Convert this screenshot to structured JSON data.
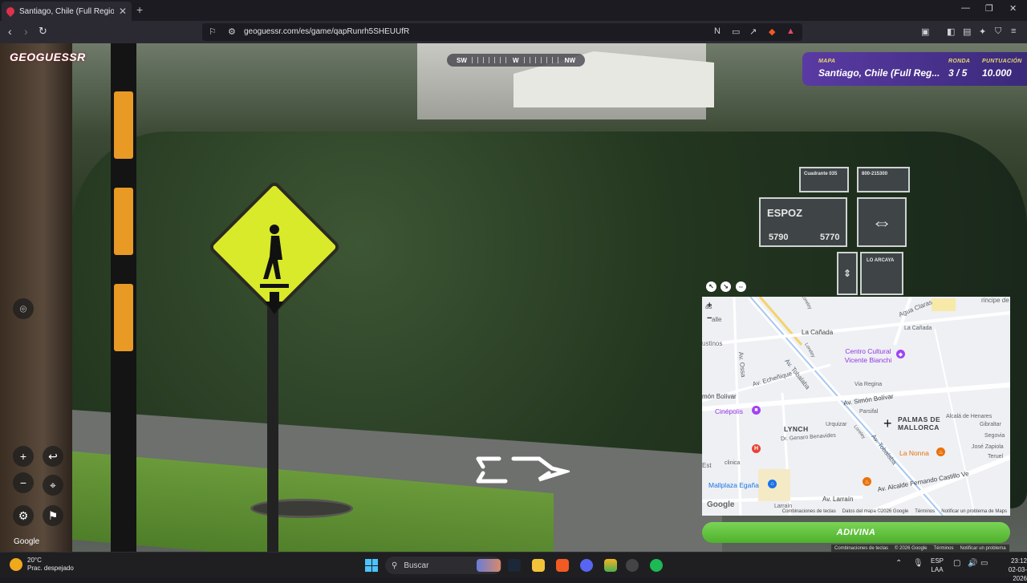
{
  "browser": {
    "tab_title": "Santiago, Chile (Full Region Met…",
    "tab_close": "✕",
    "new_tab": "+",
    "url": "geoguessr.com/es/game/qapRunrh5SHEUUfR",
    "window_controls": [
      "—",
      "❐",
      "✕"
    ]
  },
  "game": {
    "logo": "GEOGUESSR",
    "compass": {
      "left": "SW",
      "center": "W",
      "right": "NW"
    },
    "status": {
      "map_label": "MAPA",
      "map_value": "Santiago, Chile (Full Reg...",
      "round_label": "RONDA",
      "round_value": "3 / 5",
      "score_label": "PUNTUACIÓN",
      "score_value": "10.000"
    },
    "street_signs": {
      "street_name": "ESPOZ",
      "number_left": "5790",
      "number_right": "5770",
      "small_top_left": "Cuadrante 035",
      "small_top_right": "800-215300",
      "side_name": "LO ARCAYA"
    },
    "controls": {
      "zoom_in": "+",
      "zoom_out": "−",
      "undo": "↩"
    },
    "watermark": "Google"
  },
  "map": {
    "zoom_in": "+",
    "zoom_out": "−",
    "labels": {
      "la_canada_1": "La Cañada",
      "la_canada_2": "La Cañada",
      "agua_claras": "Agua Claras",
      "centro_cultural": "Centro Cultural Vicente Bianchi",
      "av_ossa": "Av. Ossa",
      "av_echenique": "Av. Echeñique",
      "av_tobalaba_1": "Av. Tobalaba",
      "av_tobalaba_2": "Av. Tobalaba",
      "via_regina": "Via Regina",
      "simon_bolivar": "Av. Simón Bolívar",
      "simon_bolivar_left": "món Bolívar",
      "parsifal": "Parsifal",
      "cinepolis": "Cinépolis",
      "lynch": "LYNCH",
      "urquizar": "Urquizar",
      "genaro": "Dr. Genaro Benavides",
      "palmas": "PALMAS DE MALLORCA",
      "alcala": "Alcalá de Henares",
      "gibraltar": "Gibraltar",
      "segovia": "Segovia",
      "jose_zapiola": "José Zapiola",
      "teruel": "Teruel",
      "la_nonna": "La Nonna",
      "mallplaza": "Mallplaza Egaña",
      "alcalde": "Av. Alcalde Fernando Castillo Ve",
      "av_larrain": "Av. Larraín",
      "larrain_short": "Larraín",
      "loreley": "Loreley",
      "loreley2": "Loreley",
      "principe": "rincipe de G",
      "ustinos": "ustinos",
      "calle": "alle",
      "las": "as",
      "est": "Est",
      "clinica": "clinica"
    },
    "footer": [
      "Combinaciones de teclas",
      "Datos del mapa ©2026 Google",
      "Términos",
      "Notificar un problema de Maps"
    ],
    "google": "Google"
  },
  "guess_button": "ADIVINA",
  "bottom_footer": [
    "Combinaciones de teclas",
    "© 2026 Google",
    "Términos",
    "Notificar un problema"
  ],
  "taskbar": {
    "temp": "20°C",
    "weather": "Prac. despejado",
    "search": "Buscar",
    "lang_top": "ESP",
    "lang_bottom": "LAA",
    "time": "23:12",
    "date": "02-03-2026"
  },
  "colors": {
    "accent_purple": "#5a3aa3",
    "guess_green": "#5fc23a",
    "status_yellow": "#e8d86b"
  }
}
